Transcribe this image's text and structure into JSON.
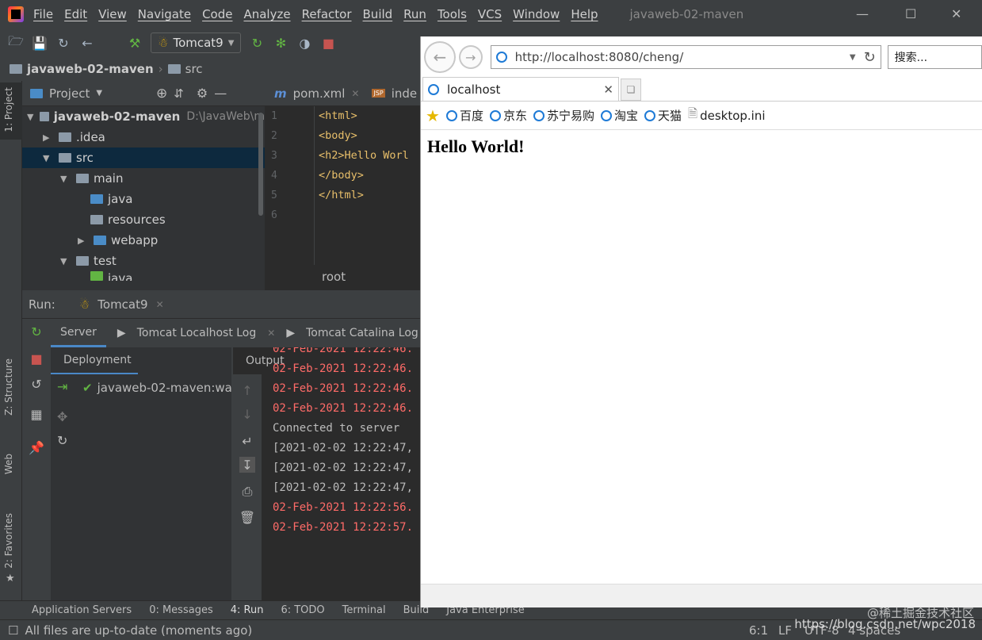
{
  "window": {
    "title": "javaweb-02-maven"
  },
  "menu": [
    "File",
    "Edit",
    "View",
    "Navigate",
    "Code",
    "Analyze",
    "Refactor",
    "Build",
    "Run",
    "Tools",
    "VCS",
    "Window",
    "Help"
  ],
  "toolbar": {
    "run_config": "Tomcat9"
  },
  "breadcrumb": {
    "project": "javaweb-02-maven",
    "folder": "src"
  },
  "left_tabs": {
    "project": "1: Project",
    "structure": "Z: Structure",
    "web": "Web",
    "favorites": "2: Favorites"
  },
  "project_panel": {
    "header": "Project",
    "tree": [
      {
        "label": "javaweb-02-maven",
        "extra": "D:\\JavaWeb\\m"
      },
      {
        "label": ".idea"
      },
      {
        "label": "src"
      },
      {
        "label": "main"
      },
      {
        "label": "java"
      },
      {
        "label": "resources"
      },
      {
        "label": "webapp"
      },
      {
        "label": "test"
      },
      {
        "label": "java"
      }
    ]
  },
  "editor": {
    "tabs": [
      "pom.xml",
      "inde"
    ],
    "lines": [
      "1",
      "2",
      "3",
      "4",
      "5",
      "6"
    ],
    "code": [
      "<html>",
      "<body>",
      "<h2>Hello Worl",
      "</body>",
      "</html>",
      ""
    ],
    "breadcrumb": "root"
  },
  "run": {
    "label": "Run:",
    "config": "Tomcat9",
    "tabs": [
      "Server",
      "Tomcat Localhost Log",
      "Tomcat Catalina Log"
    ],
    "deployment_header": "Deployment",
    "output_header": "Output",
    "deployment_item": "javaweb-02-maven:war",
    "log": [
      {
        "text": "02-Feb-2021 12:22:46.",
        "color": "red"
      },
      {
        "text": "02-Feb-2021 12:22:46.",
        "color": "red"
      },
      {
        "text": "02-Feb-2021 12:22:46.",
        "color": "red"
      },
      {
        "text": "02-Feb-2021 12:22:46.",
        "color": "red"
      },
      {
        "text": "Connected to server",
        "color": "gray"
      },
      {
        "text": "[2021-02-02 12:22:47,",
        "color": "gray"
      },
      {
        "text": "[2021-02-02 12:22:47,",
        "color": "gray"
      },
      {
        "text": "[2021-02-02 12:22:47,",
        "color": "gray"
      },
      {
        "text": "02-Feb-2021 12:22:56.",
        "color": "red"
      },
      {
        "text": "02-Feb-2021 12:22:57.",
        "color": "red"
      }
    ]
  },
  "bottom_tabs": [
    "Application Servers",
    "0: Messages",
    "4: Run",
    "6: TODO",
    "Terminal",
    "Build",
    "Java Enterprise"
  ],
  "status": {
    "message": "All files are up-to-date (moments ago)",
    "position": "6:1",
    "line_sep": "LF",
    "encoding": "UTF-8",
    "indent": "4 spaces"
  },
  "browser": {
    "url": "http://localhost:8080/cheng/",
    "search_placeholder": "搜索...",
    "tab_title": "localhost",
    "favorites": [
      "百度",
      "京东",
      "苏宁易购",
      "淘宝",
      "天猫",
      "desktop.ini"
    ],
    "heading": "Hello World!"
  },
  "watermark": {
    "line1": "@稀土掘金技术社区",
    "line2": "https://blog.csdn.net/wpc2018"
  },
  "colors": {
    "ide_bg": "#3c3f41",
    "editor_bg": "#2b2b2b",
    "log_red": "#ff6b68",
    "tag_yellow": "#e8bf6a",
    "selection": "#0d293e"
  }
}
